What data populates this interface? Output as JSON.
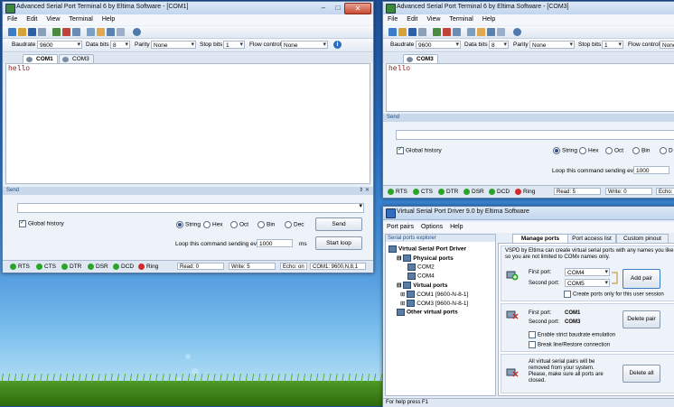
{
  "term1": {
    "title": "Advanced Serial Port Terminal 6 by Eltima Software - [COM1]",
    "menu": [
      "File",
      "Edit",
      "View",
      "Terminal",
      "Help"
    ],
    "params": {
      "baudrate_label": "Baudrate",
      "baudrate": "9600",
      "databits_label": "Data bits",
      "databits": "8",
      "parity_label": "Parity",
      "parity": "None",
      "stopbits_label": "Stop bits",
      "stopbits": "1",
      "flow_label": "Flow control",
      "flow": "None"
    },
    "tabs": [
      "COM1",
      "COM3"
    ],
    "output": "hello",
    "send": {
      "header": "Send",
      "global_history": "Global history",
      "radios": [
        "String",
        "Hex",
        "Oct",
        "Bin",
        "Dec"
      ],
      "send_button": "Send",
      "loop_label": "Loop this command sending every",
      "loop_value": "1000",
      "loop_unit": "ms",
      "start_loop": "Start loop"
    },
    "status": {
      "leds": [
        "RTS",
        "CTS",
        "DTR",
        "DSR",
        "DCD",
        "Ring"
      ],
      "read": "Read: 0",
      "write": "Write: 5",
      "echo": "Echo: on",
      "port": "COM1: 9600,N,8,1"
    }
  },
  "term3": {
    "title": "Advanced Serial Port Terminal 6 by Eltima Software - [COM3]",
    "menu": [
      "File",
      "Edit",
      "View",
      "Terminal",
      "Help"
    ],
    "params": {
      "baudrate_label": "Baudrate",
      "baudrate": "9600",
      "databits_label": "Data bits",
      "databits": "8",
      "parity_label": "Parity",
      "parity": "None",
      "stopbits_label": "Stop bits",
      "stopbits": "1",
      "flow_label": "Flow control",
      "flow": "None"
    },
    "tabs": [
      "COM3"
    ],
    "output": "hello",
    "send": {
      "header": "Send",
      "global_history": "Global history",
      "radios": [
        "String",
        "Hex",
        "Oct",
        "Bin",
        "D"
      ],
      "loop_label": "Loop this command sending every",
      "loop_value": "1000"
    },
    "status": {
      "leds": [
        "RTS",
        "CTS",
        "DTR",
        "DSR",
        "DCD",
        "Ring"
      ],
      "read": "Read: 5",
      "write": "Write: 0",
      "echo": "Echo: of"
    }
  },
  "vspd": {
    "title": "Virtual Serial Port Driver 9.0 by Eltima Software",
    "menu": [
      "Port pairs",
      "Options",
      "Help"
    ],
    "explorer_header": "Serial ports explorer",
    "tree": {
      "root": "Virtual Serial Port Driver",
      "physical": "Physical ports",
      "com2": "COM2",
      "com4": "COM4",
      "virtual": "Virtual ports",
      "v1": "COM1 [9600-N-8-1]",
      "v3": "COM3 [9600-N-8-1]",
      "other": "Other virtual ports"
    },
    "tabs": [
      "Manage ports",
      "Port access list",
      "Custom pinout"
    ],
    "intro": "VSPD by Eltima can create virtual serial ports with any names you like,\nso you are not limited to COMx names only.",
    "add": {
      "first_label": "First port:",
      "first_value": "COM4",
      "second_label": "Second port:",
      "second_value": "COM5",
      "button": "Add pair",
      "session": "Create ports only for this user session"
    },
    "del": {
      "first_label": "First port:",
      "first_value": "COM1",
      "second_label": "Second port:",
      "second_value": "COM3",
      "button": "Delete pair",
      "strict": "Enable strict baudrate emulation",
      "breakline": "Break line/Restore connection"
    },
    "delall": {
      "text": "All virtual serial pairs will be\nremoved from your system.\nPlease, make sure all ports are\nclosed.",
      "button": "Delete all"
    },
    "status": "For help press F1"
  }
}
